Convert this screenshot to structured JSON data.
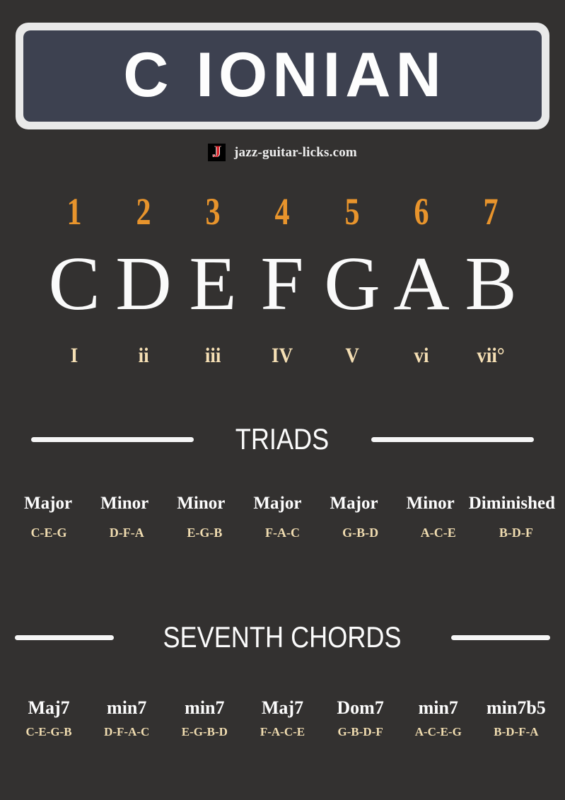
{
  "colors": {
    "background": "#333130",
    "banner_border": "#e9e9e9",
    "banner_fill": "#3d4150",
    "accent_orange": "#e8942c",
    "accent_cream": "#f0dcb0",
    "text_white": "#fbfbfb",
    "logo_red": "#d81f26"
  },
  "banner": {
    "title": "C IONIAN"
  },
  "brand": {
    "logo_glyph": "J",
    "site": "jazz-guitar-licks.com"
  },
  "scale": {
    "degrees": [
      "1",
      "2",
      "3",
      "4",
      "5",
      "6",
      "7"
    ],
    "notes": [
      "C",
      "D",
      "E",
      "F",
      "G",
      "A",
      "B"
    ],
    "numerals": [
      "I",
      "ii",
      "iii",
      "IV",
      "V",
      "vi",
      "vii°"
    ]
  },
  "triads": {
    "heading": "TRIADS",
    "qualities": [
      "Major",
      "Minor",
      "Minor",
      "Major",
      "Major",
      "Minor",
      "Diminished"
    ],
    "spellings": [
      "C-E-G",
      "D-F-A",
      "E-G-B",
      "F-A-C",
      "G-B-D",
      "A-C-E",
      "B-D-F"
    ]
  },
  "sevenths": {
    "heading": "SEVENTH CHORDS",
    "qualities": [
      "Maj7",
      "min7",
      "min7",
      "Maj7",
      "Dom7",
      "min7",
      "min7b5"
    ],
    "spellings": [
      "C-E-G-B",
      "D-F-A-C",
      "E-G-B-D",
      "F-A-C-E",
      "G-B-D-F",
      "A-C-E-G",
      "B-D-F-A"
    ]
  }
}
